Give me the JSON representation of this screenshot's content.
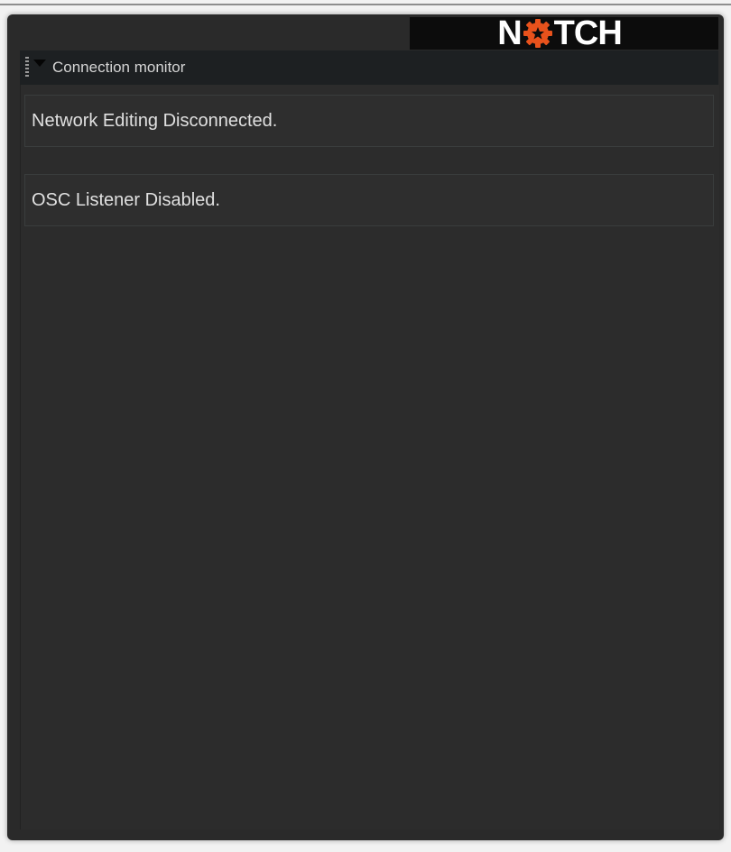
{
  "logo": {
    "left_text": "N",
    "right_text": "TCH",
    "gear_color": "#e8521c"
  },
  "panel": {
    "title": "Connection monitor",
    "expand_icon": "chevron-down-icon"
  },
  "status": {
    "network_editing": "Network Editing Disconnected.",
    "osc_listener": "OSC Listener Disabled."
  }
}
